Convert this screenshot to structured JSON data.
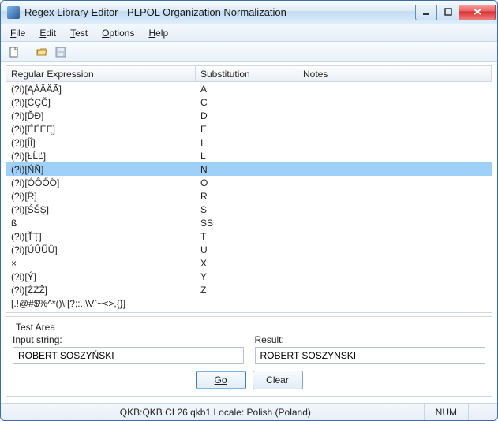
{
  "window": {
    "title": "Regex Library Editor - PLPOL Organization Normalization"
  },
  "menu": {
    "file": "File",
    "edit": "Edit",
    "test": "Test",
    "options": "Options",
    "help": "Help"
  },
  "columns": {
    "regex": "Regular Expression",
    "sub": "Substitution",
    "notes": "Notes"
  },
  "rows": [
    {
      "regex": "(?i)[ĄÁÂÄÃ]",
      "sub": "A",
      "notes": "",
      "selected": false
    },
    {
      "regex": "(?i)[ĆÇČ]",
      "sub": "C",
      "notes": "",
      "selected": false
    },
    {
      "regex": "(?i)[ĎĐ]",
      "sub": "D",
      "notes": "",
      "selected": false
    },
    {
      "regex": "(?i)[ÉĚËĘ]",
      "sub": "E",
      "notes": "",
      "selected": false
    },
    {
      "regex": "(?i)[ÍÎ]",
      "sub": "I",
      "notes": "",
      "selected": false
    },
    {
      "regex": "(?i)[ŁĹĽ]",
      "sub": "L",
      "notes": "",
      "selected": false
    },
    {
      "regex": "(?i)[ŃŇ]",
      "sub": "N",
      "notes": "",
      "selected": true
    },
    {
      "regex": "(?i)[ÓÔŐÖ]",
      "sub": "O",
      "notes": "",
      "selected": false
    },
    {
      "regex": "(?i)[Ř]",
      "sub": "R",
      "notes": "",
      "selected": false
    },
    {
      "regex": "(?i)[ŚŠŞ]",
      "sub": "S",
      "notes": "",
      "selected": false
    },
    {
      "regex": "ß",
      "sub": "SS",
      "notes": "",
      "selected": false
    },
    {
      "regex": "(?i)[ŤŢ]",
      "sub": "T",
      "notes": "",
      "selected": false
    },
    {
      "regex": "(?i)[ÚÛŰÜ]",
      "sub": "U",
      "notes": "",
      "selected": false
    },
    {
      "regex": "×",
      "sub": "X",
      "notes": "",
      "selected": false
    },
    {
      "regex": "(?i)[Ý]",
      "sub": "Y",
      "notes": "",
      "selected": false
    },
    {
      "regex": "(?i)[ŹŻŽ]",
      "sub": "Z",
      "notes": "",
      "selected": false
    },
    {
      "regex": "[.!@#$%^*()\\|[?;:.|\\V`~<>,{}]",
      "sub": "",
      "notes": "",
      "selected": false
    }
  ],
  "test": {
    "legend": "Test Area",
    "input_label": "Input string:",
    "result_label": "Result:",
    "input_value": "ROBERT SOSZYŃSKI",
    "result_value": "ROBERT SOSZYNSKI",
    "go_label": "Go",
    "clear_label": "Clear"
  },
  "status": {
    "center": "QKB:QKB CI 26 qkb1    Locale: Polish (Poland)",
    "num": "NUM"
  }
}
